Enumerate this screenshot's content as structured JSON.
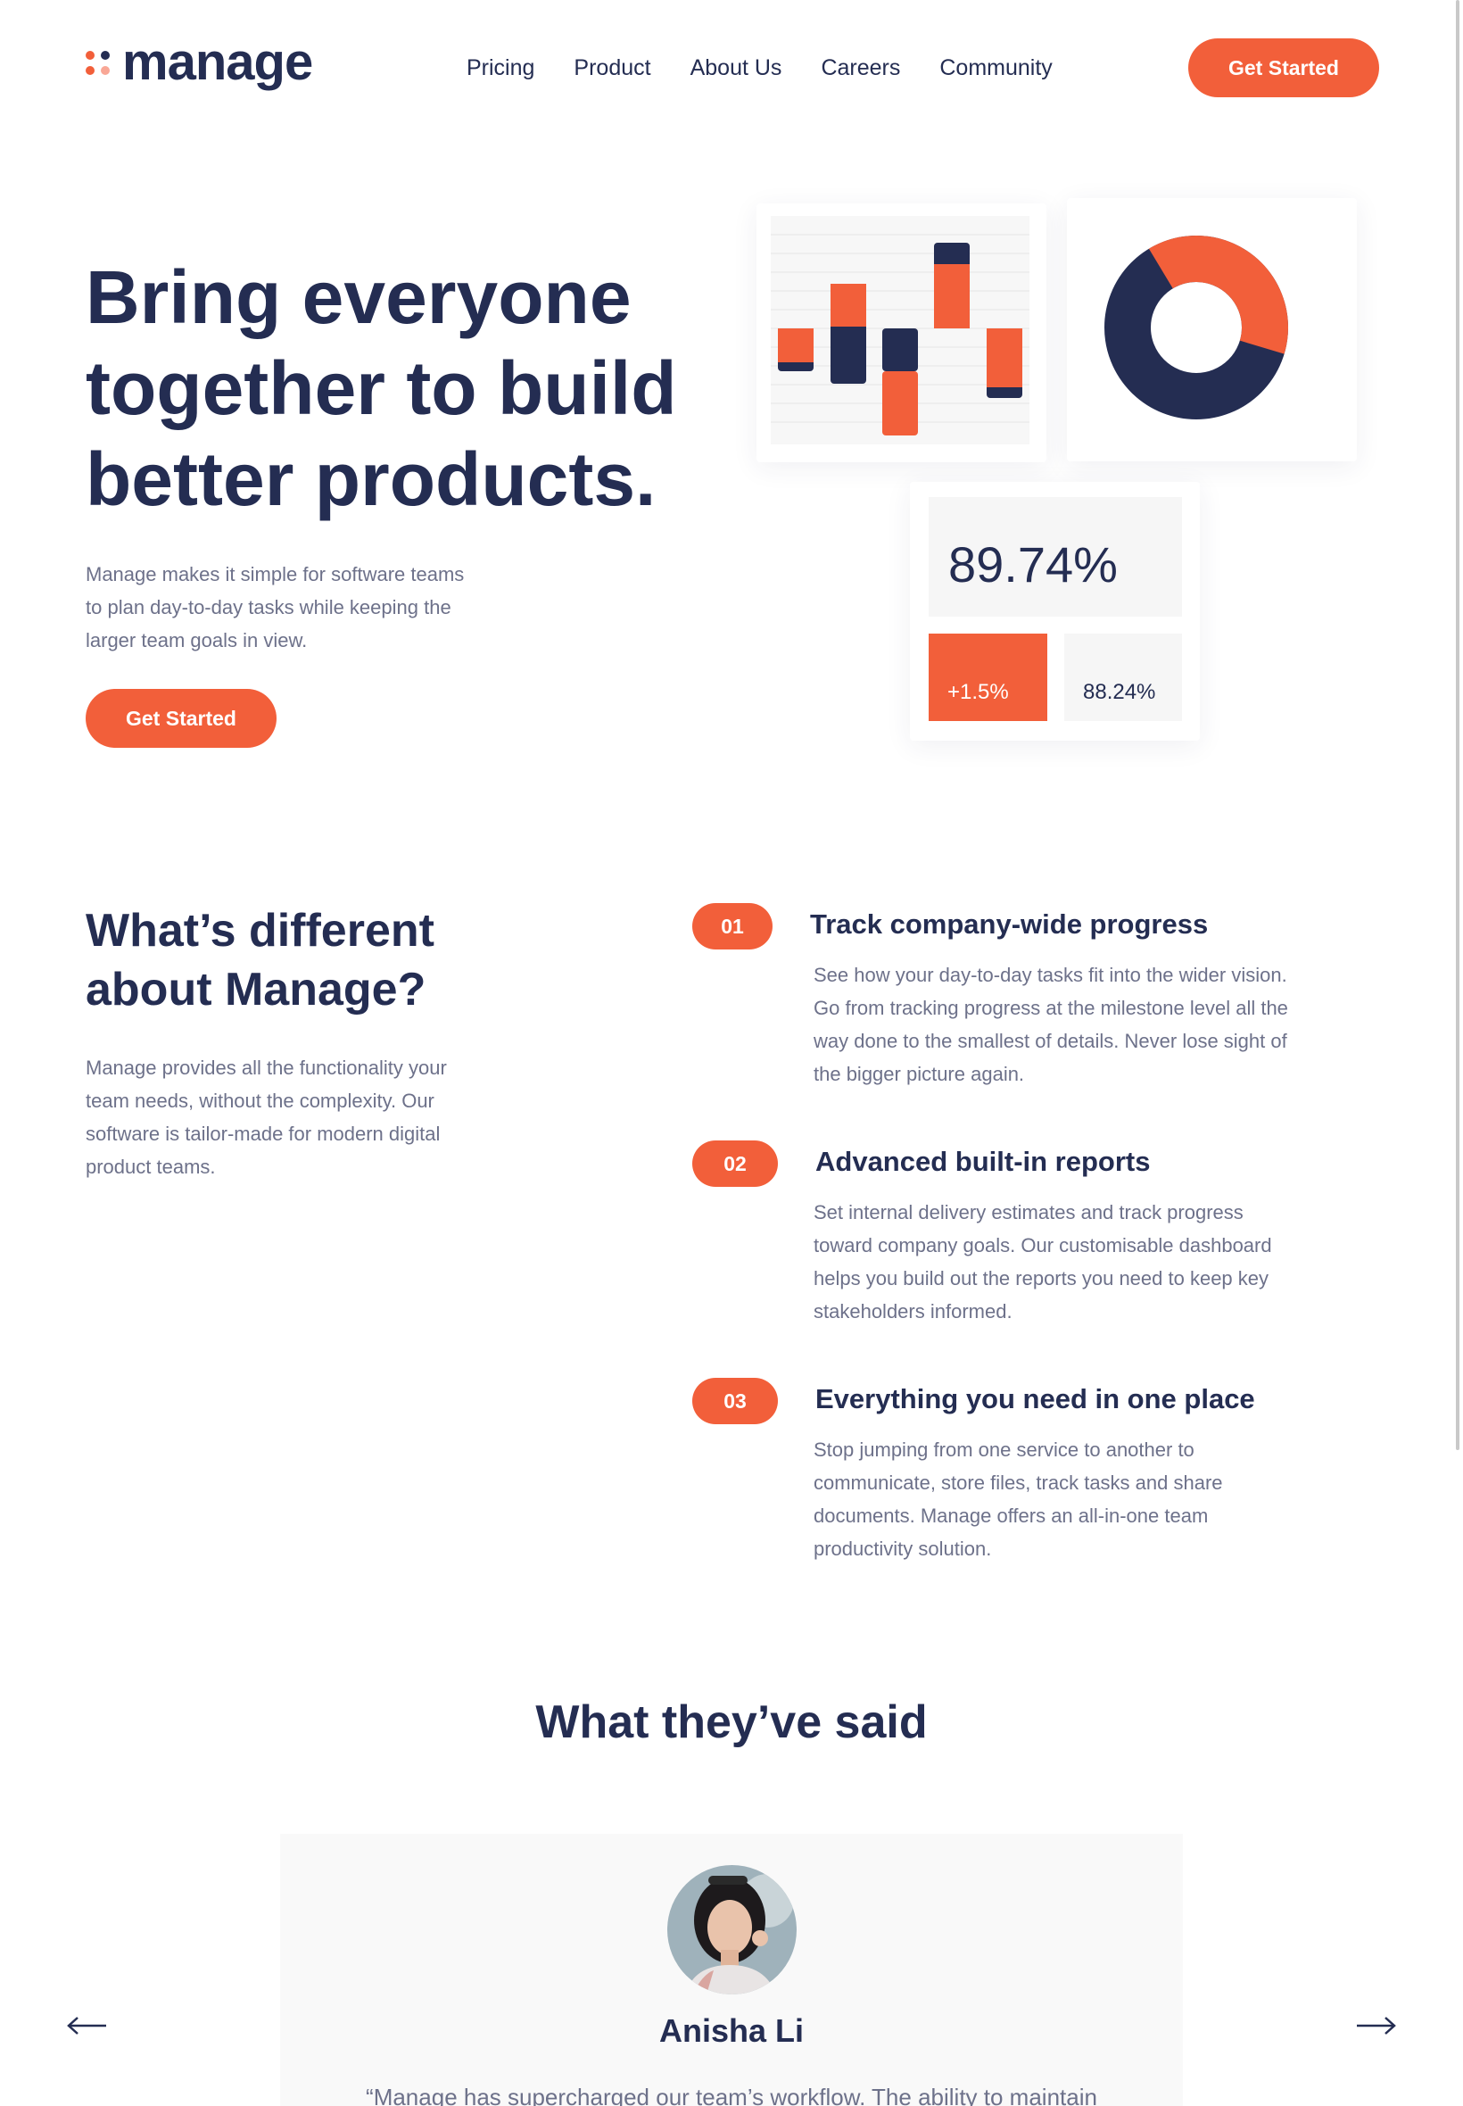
{
  "brand": {
    "name": "manage",
    "accent": "#f25f3a",
    "navy": "#242d52",
    "dot_colors": [
      "#f25f3a",
      "#242d52",
      "#f25f3a",
      "#f9a796"
    ]
  },
  "nav": {
    "items": [
      "Pricing",
      "Product",
      "About Us",
      "Careers",
      "Community"
    ],
    "cta_label": "Get Started"
  },
  "hero": {
    "title": "Bring everyone together to build better products.",
    "description": "Manage makes it simple for software teams to plan day-to-day tasks while keeping the larger team goals in view.",
    "cta_label": "Get Started"
  },
  "illustration": {
    "stat_main": "89.74%",
    "stat_change": "+1.5%",
    "stat_secondary": "88.24%"
  },
  "features": {
    "title": "What’s different about Manage?",
    "description": "Manage provides all the functionality your team needs, without the complexity. Our software is tailor-made for modern digital product teams.",
    "items": [
      {
        "number": "01",
        "title": "Track company-wide progress",
        "description": "See how your day-to-day tasks fit into the wider vision. Go from tracking progress at the milestone level all the way done to the smallest of details. Never lose sight of the bigger picture again."
      },
      {
        "number": "02",
        "title": "Advanced built-in reports",
        "description": "Set internal delivery estimates and track progress toward company goals. Our customisable dashboard helps you build out the reports you need to keep key stakeholders informed."
      },
      {
        "number": "03",
        "title": "Everything you need in one place",
        "description": "Stop jumping from one service to another to communicate, store files, track tasks and share documents. Manage offers an all-in-one team productivity solution."
      }
    ]
  },
  "testimonials": {
    "title": "What they’ve said",
    "name": "Anisha Li",
    "quote": "“Manage has supercharged our team’s workflow. The ability to maintain",
    "prev_icon": "arrow-left-icon",
    "next_icon": "arrow-right-icon"
  }
}
